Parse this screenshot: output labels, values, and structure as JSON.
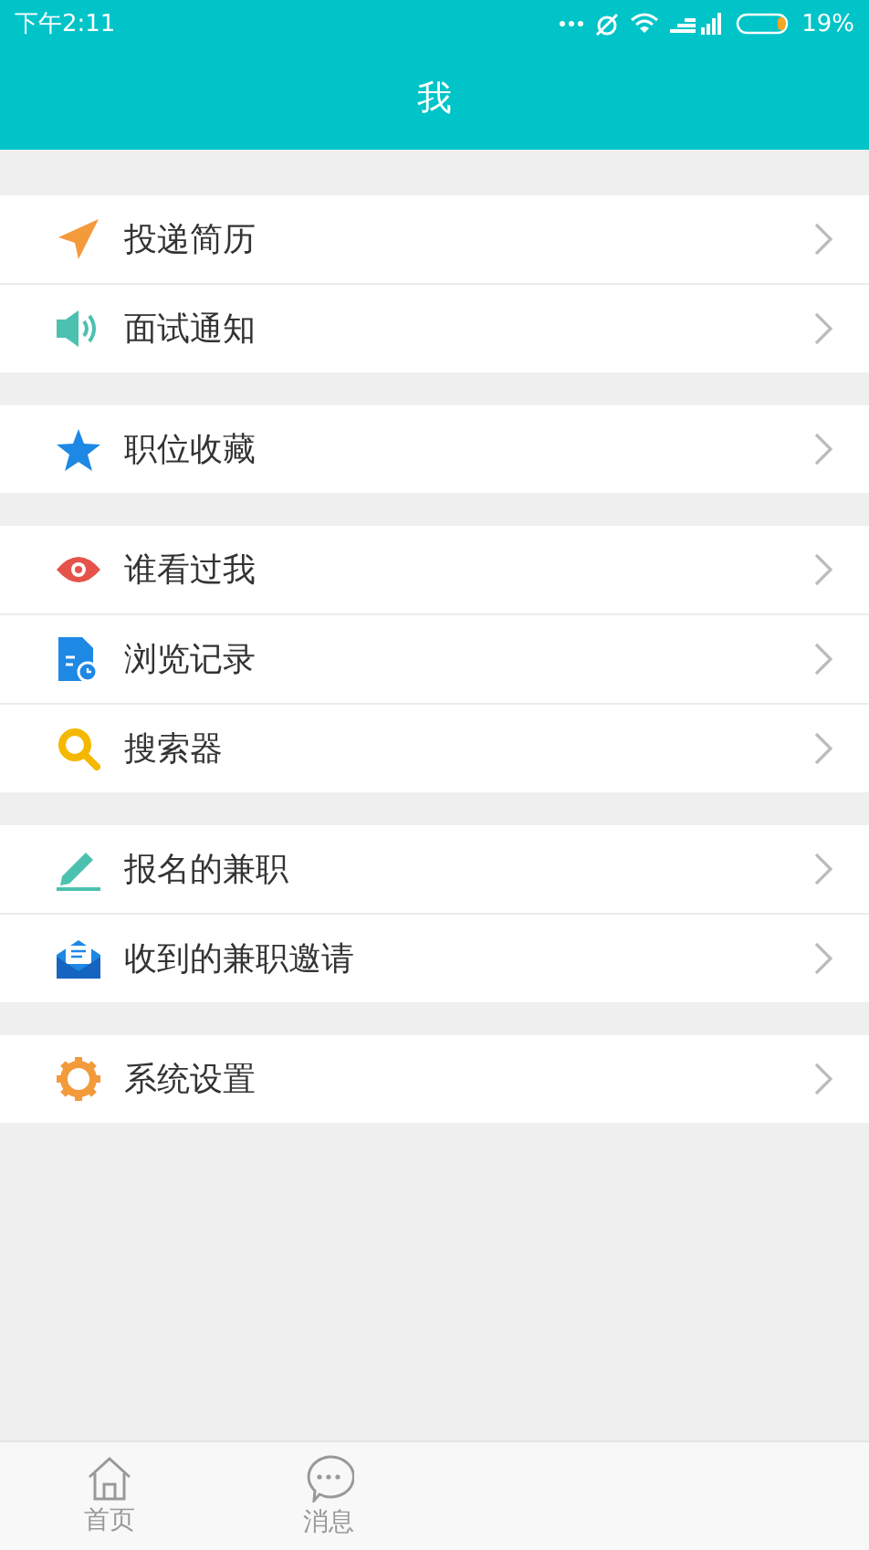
{
  "status_bar": {
    "time": "下午2:11",
    "battery": "19%"
  },
  "header": {
    "title": "我"
  },
  "groups": [
    {
      "items": [
        {
          "label": "投递简历"
        },
        {
          "label": "面试通知"
        }
      ]
    },
    {
      "items": [
        {
          "label": "职位收藏"
        }
      ]
    },
    {
      "items": [
        {
          "label": "谁看过我"
        },
        {
          "label": "浏览记录"
        },
        {
          "label": "搜索器"
        }
      ]
    },
    {
      "items": [
        {
          "label": "报名的兼职"
        },
        {
          "label": "收到的兼职邀请"
        }
      ]
    },
    {
      "items": [
        {
          "label": "系统设置"
        }
      ]
    }
  ],
  "bottom_nav": [
    {
      "label": "首页",
      "selected": false
    },
    {
      "label": "消息",
      "selected": false
    }
  ]
}
